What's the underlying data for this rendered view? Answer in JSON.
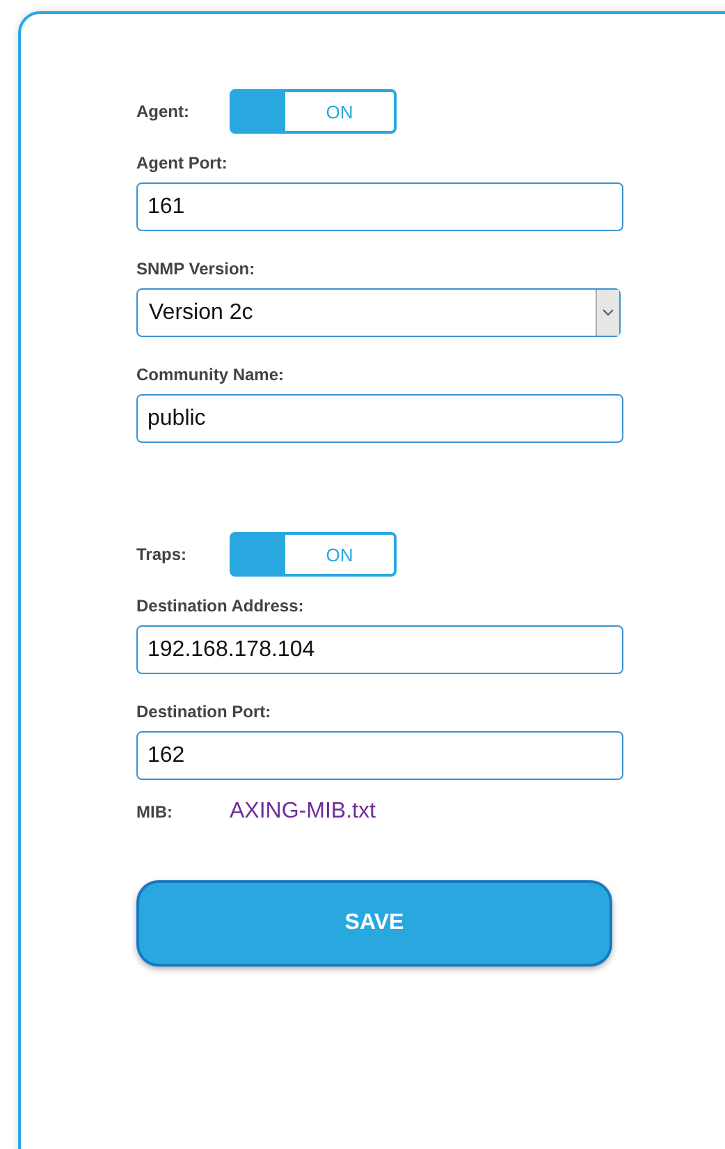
{
  "fields": [
    {
      "kind": "toggle",
      "label": "Agent:",
      "on": true,
      "state_text": "ON"
    },
    {
      "kind": "text",
      "label": "Agent Port:",
      "value": "161"
    },
    {
      "kind": "select",
      "label": "SNMP Version:",
      "value": "Version 2c"
    },
    {
      "kind": "text",
      "label": "Community Name:",
      "value": "public"
    },
    {
      "kind": "toggle",
      "label": "Traps:",
      "on": true,
      "state_text": "ON"
    },
    {
      "kind": "text",
      "label": "Destination Address:",
      "value": "192.168.178.104"
    },
    {
      "kind": "text",
      "label": "Destination Port:",
      "value": "162"
    },
    {
      "kind": "link",
      "label": "MIB:",
      "value": "AXING-MIB.txt"
    }
  ],
  "save_button": "SAVE"
}
